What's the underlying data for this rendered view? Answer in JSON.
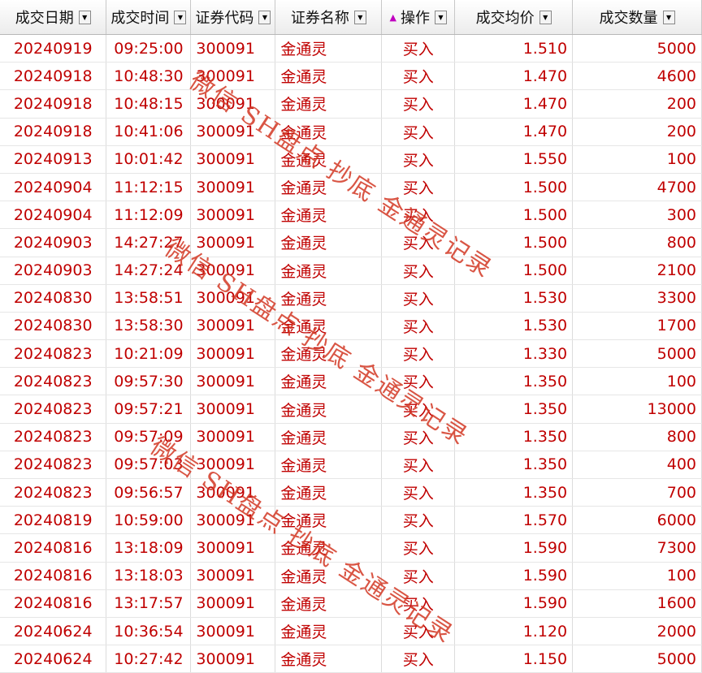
{
  "columns": [
    {
      "key": "date",
      "label": "成交日期",
      "align": "ctr",
      "width": 131
    },
    {
      "key": "time",
      "label": "成交时间",
      "align": "ctr",
      "width": 104
    },
    {
      "key": "code",
      "label": "证券代码",
      "align": "lft",
      "width": 104
    },
    {
      "key": "name",
      "label": "证券名称",
      "align": "lft",
      "width": 131
    },
    {
      "key": "action",
      "label": "操作",
      "align": "ctr",
      "width": 90,
      "sorted": true
    },
    {
      "key": "price",
      "label": "成交均价",
      "align": "num",
      "width": 145
    },
    {
      "key": "qty",
      "label": "成交数量",
      "align": "num",
      "width": 159
    }
  ],
  "sort_indicator": "▲",
  "dropdown_glyph": "▼",
  "rows": [
    [
      "20240919",
      "09:25:00",
      "300091",
      "金通灵",
      "买入",
      "1.510",
      "5000"
    ],
    [
      "20240918",
      "10:48:30",
      "300091",
      "金通灵",
      "买入",
      "1.470",
      "4600"
    ],
    [
      "20240918",
      "10:48:15",
      "300091",
      "金通灵",
      "买入",
      "1.470",
      "200"
    ],
    [
      "20240918",
      "10:41:06",
      "300091",
      "金通灵",
      "买入",
      "1.470",
      "200"
    ],
    [
      "20240913",
      "10:01:42",
      "300091",
      "金通灵",
      "买入",
      "1.550",
      "100"
    ],
    [
      "20240904",
      "11:12:15",
      "300091",
      "金通灵",
      "买入",
      "1.500",
      "4700"
    ],
    [
      "20240904",
      "11:12:09",
      "300091",
      "金通灵",
      "买入",
      "1.500",
      "300"
    ],
    [
      "20240903",
      "14:27:27",
      "300091",
      "金通灵",
      "买入",
      "1.500",
      "800"
    ],
    [
      "20240903",
      "14:27:24",
      "300091",
      "金通灵",
      "买入",
      "1.500",
      "2100"
    ],
    [
      "20240830",
      "13:58:51",
      "300091",
      "金通灵",
      "买入",
      "1.530",
      "3300"
    ],
    [
      "20240830",
      "13:58:30",
      "300091",
      "金通灵",
      "买入",
      "1.530",
      "1700"
    ],
    [
      "20240823",
      "10:21:09",
      "300091",
      "金通灵",
      "买入",
      "1.330",
      "5000"
    ],
    [
      "20240823",
      "09:57:30",
      "300091",
      "金通灵",
      "买入",
      "1.350",
      "100"
    ],
    [
      "20240823",
      "09:57:21",
      "300091",
      "金通灵",
      "买入",
      "1.350",
      "13000"
    ],
    [
      "20240823",
      "09:57:09",
      "300091",
      "金通灵",
      "买入",
      "1.350",
      "800"
    ],
    [
      "20240823",
      "09:57:03",
      "300091",
      "金通灵",
      "买入",
      "1.350",
      "400"
    ],
    [
      "20240823",
      "09:56:57",
      "300091",
      "金通灵",
      "买入",
      "1.350",
      "700"
    ],
    [
      "20240819",
      "10:59:00",
      "300091",
      "金通灵",
      "买入",
      "1.570",
      "6000"
    ],
    [
      "20240816",
      "13:18:09",
      "300091",
      "金通灵",
      "买入",
      "1.590",
      "7300"
    ],
    [
      "20240816",
      "13:18:03",
      "300091",
      "金通灵",
      "买入",
      "1.590",
      "100"
    ],
    [
      "20240816",
      "13:17:57",
      "300091",
      "金通灵",
      "买入",
      "1.590",
      "1600"
    ],
    [
      "20240624",
      "10:36:54",
      "300091",
      "金通灵",
      "买入",
      "1.120",
      "2000"
    ],
    [
      "20240624",
      "10:27:42",
      "300091",
      "金通灵",
      "买入",
      "1.150",
      "5000"
    ]
  ],
  "watermarks": [
    "微信 SH盘点 抄底 金通灵记录",
    "微信 SH盘点 抄底 金通灵记录",
    "微信 SH盘点 抄底 金通灵记录",
    "微信 SH盘点 抄底 金通灵记录"
  ],
  "colors": {
    "row_text": "#c00000",
    "watermark": "#d23723",
    "sort_indicator": "#c000c0"
  }
}
